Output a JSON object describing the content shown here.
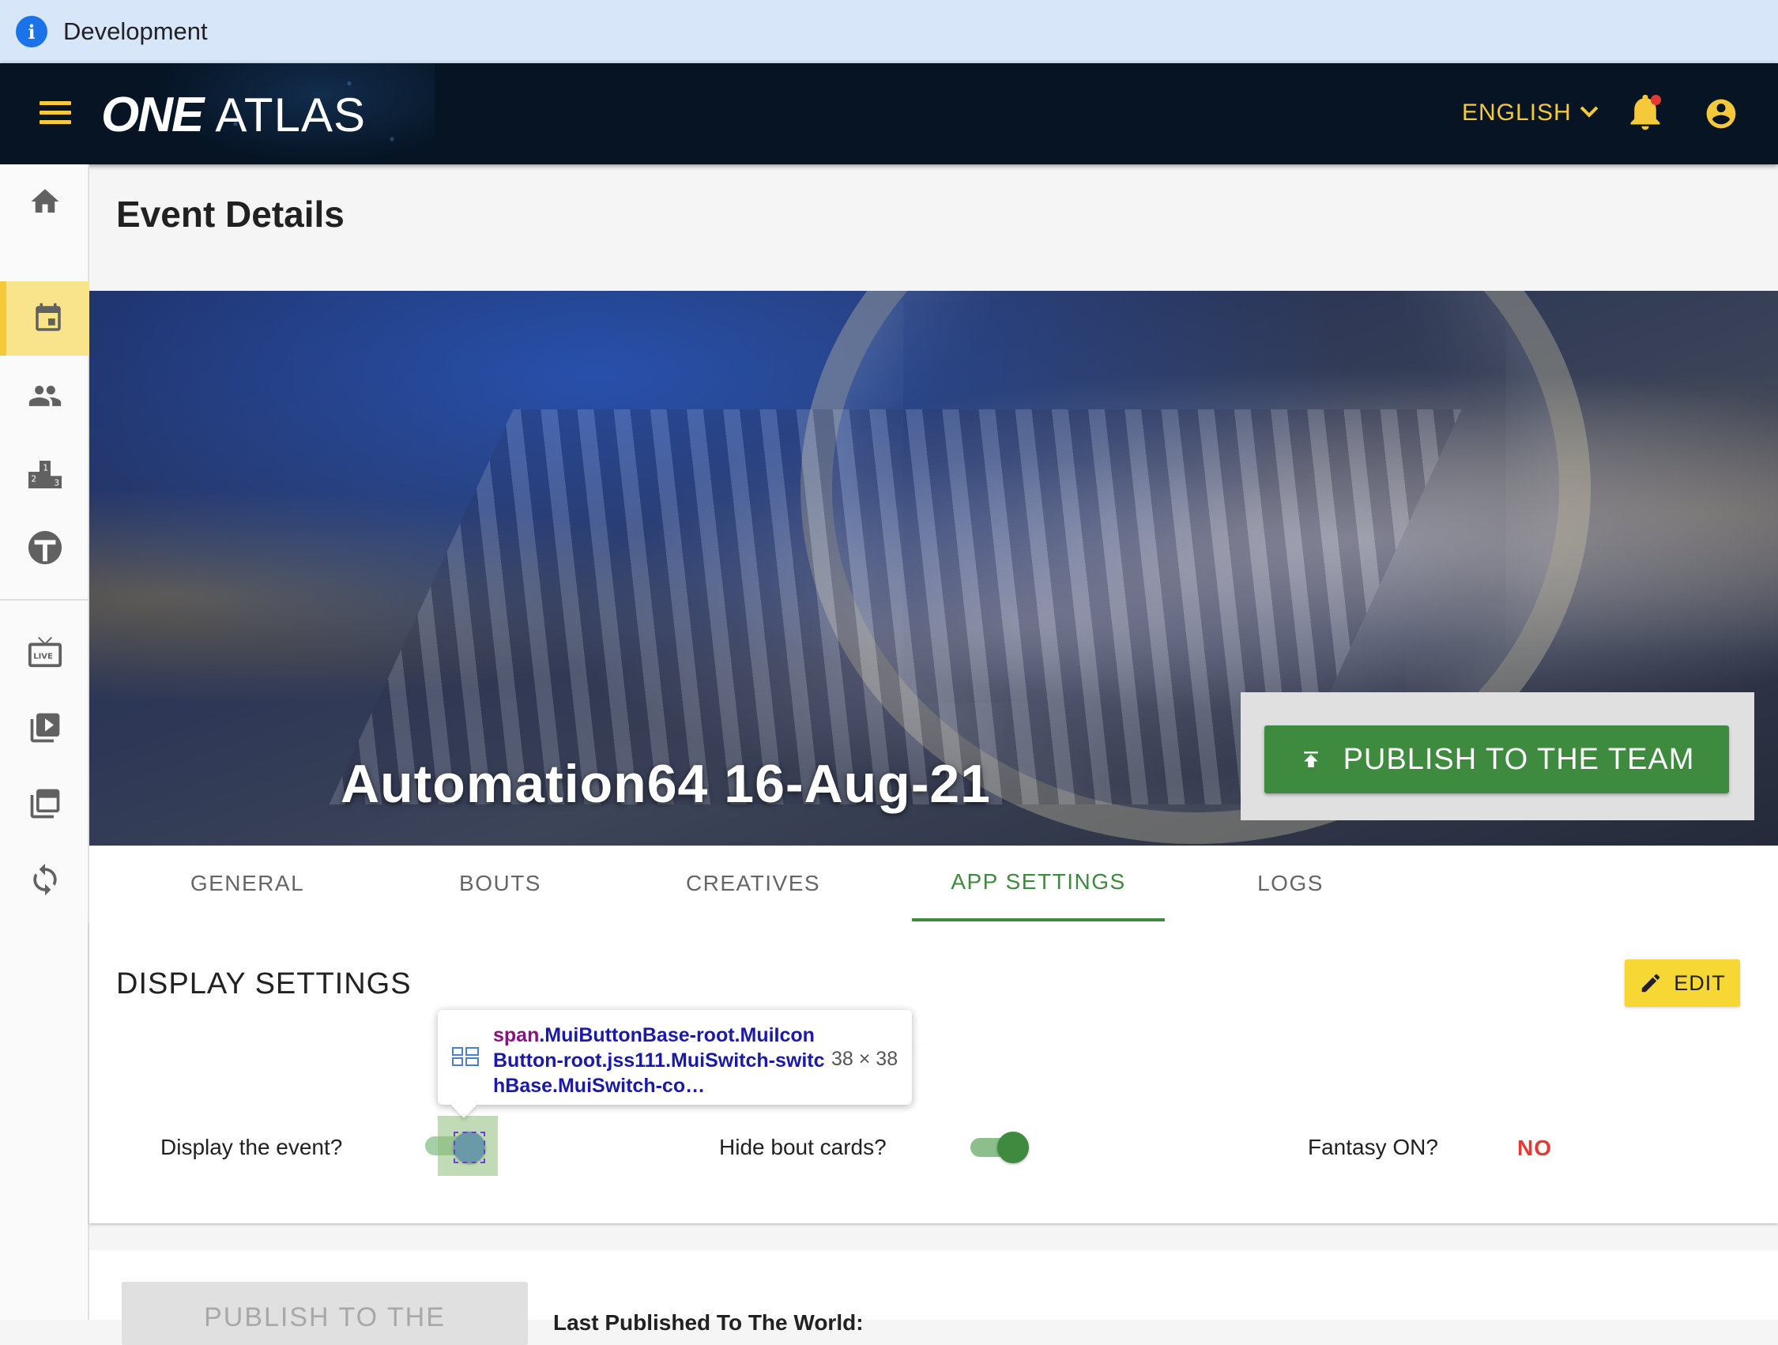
{
  "banner": {
    "label": "Development",
    "icon": "info-icon"
  },
  "appbar": {
    "logo_one": "ONE",
    "logo_atlas": "ATLAS",
    "language": "ENGLISH",
    "accent_color": "#f6c93a"
  },
  "sidebar": {
    "items": [
      {
        "icon": "home-icon"
      },
      {
        "icon": "calendar-icon",
        "active": true
      },
      {
        "icon": "people-icon"
      },
      {
        "icon": "podium-icon"
      },
      {
        "icon": "brand-icon"
      },
      {
        "icon": "live-tv-icon"
      },
      {
        "icon": "video-library-icon"
      },
      {
        "icon": "collections-icon"
      },
      {
        "icon": "sync-icon"
      }
    ]
  },
  "page": {
    "title": "Event Details"
  },
  "hero": {
    "event_name": "Automation64 16-Aug-21",
    "publish_label": "PUBLISH TO THE TEAM",
    "publish_color": "#3e8a3e"
  },
  "tabs": [
    {
      "label": "GENERAL"
    },
    {
      "label": "BOUTS"
    },
    {
      "label": "CREATIVES"
    },
    {
      "label": "APP SETTINGS",
      "active": true
    },
    {
      "label": "LOGS"
    }
  ],
  "display_settings": {
    "title": "DISPLAY SETTINGS",
    "edit_label": "EDIT",
    "fields": {
      "display_event": {
        "label": "Display the event?",
        "on": false
      },
      "hide_bout_cards": {
        "label": "Hide bout cards?",
        "on": true
      },
      "fantasy": {
        "label": "Fantasy ON?",
        "value": "NO"
      }
    }
  },
  "tooltip": {
    "tag": "span",
    "classes": ".MuiButtonBase-root.MuiIconButton-root.jss111.MuiSwitch-switchBase.MuiSwitch-co…",
    "size": "38 × 38"
  },
  "bottom": {
    "publish_world_label": "PUBLISH TO THE",
    "last_published_label": "Last Published To The World:"
  }
}
